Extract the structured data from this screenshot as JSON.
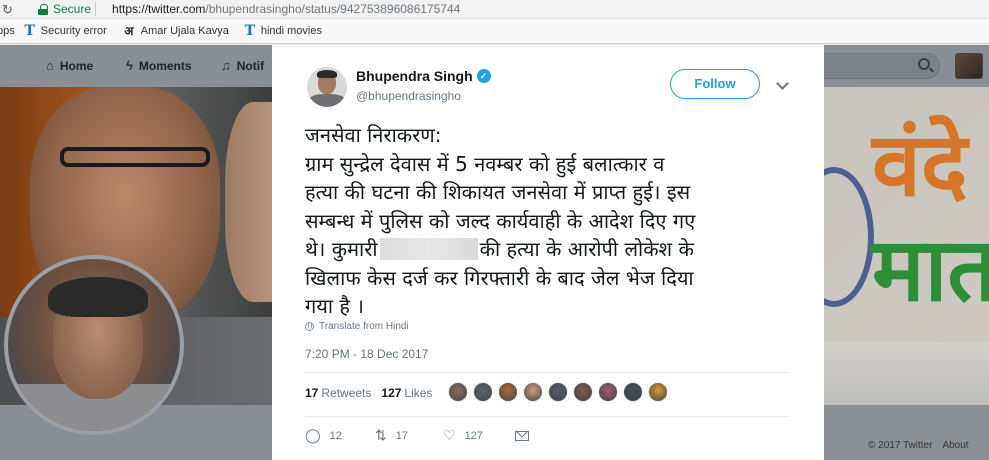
{
  "browser": {
    "secure_label": "Secure",
    "url_host": "https://twitter.com",
    "url_path": "/bhupendrasingho/status/942753896086175744",
    "reload_icon": "reload-icon"
  },
  "bookmarks": [
    {
      "label": "pps",
      "icon": "apps-icon"
    },
    {
      "label": "Security error",
      "icon": "t-logo-icon"
    },
    {
      "label": "Amar Ujala Kavya",
      "icon": "amar-ujala-icon"
    },
    {
      "label": "hindi movies",
      "icon": "t-logo-icon"
    }
  ],
  "twitter_nav": {
    "home": "Home",
    "moments": "Moments",
    "notifications": "Notif",
    "search_placeholder": "r"
  },
  "tweet": {
    "author_name": "Bhupendra Singh",
    "handle": "@bhupendrasingho",
    "follow_label": "Follow",
    "text_lines": [
      "जनसेवा निराकरण:",
      "ग्राम सुन्द्रेल देवास में 5 नवम्बर को हुई बलात्कार व",
      "हत्या की घटना की शिकायत जनसेवा में प्राप्त हुई। इस",
      "सम्बन्ध में पुलिस को जल्द कार्यवाही के आदेश दिए गए",
      "थे। कुमारी",
      "की हत्या के आरोपी लोकेश के",
      "खिलाफ केस दर्ज कर गिरफ्तारी के बाद जेल भेज दिया",
      "गया है ।"
    ],
    "translate_label": "Translate from Hindi",
    "timestamp": "7:20 PM - 18 Dec 2017",
    "retweets_count": "17",
    "retweets_label": "Retweets",
    "likes_count": "127",
    "likes_label": "Likes",
    "reply_count": "12",
    "retweet_action_count": "17",
    "like_action_count": "127",
    "liker_colors": [
      "#8a6f5c",
      "#5b6470",
      "#b06a3a",
      "#c9a07e",
      "#4a5d6e",
      "#7a5a4a",
      "#a05b6b",
      "#3f4f5f",
      "#d89a30"
    ]
  },
  "footer": {
    "copyright": "© 2017 Twitter",
    "about": "About"
  },
  "colors": {
    "twitter_blue": "#1da1f2",
    "secure_green": "#0b8043"
  }
}
